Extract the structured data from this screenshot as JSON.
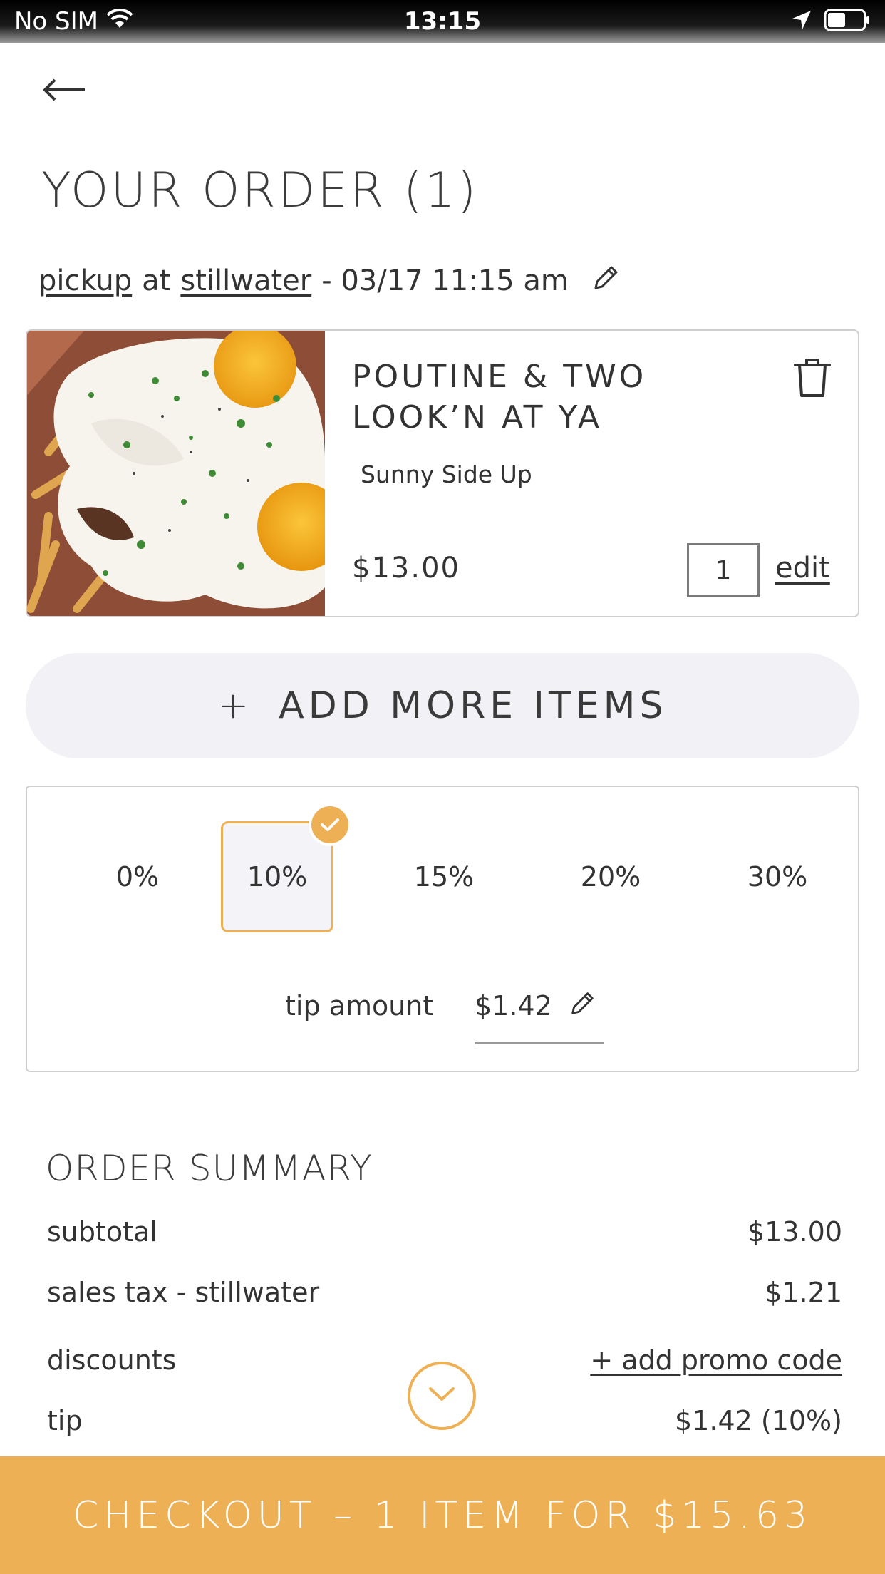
{
  "status_bar": {
    "carrier": "No SIM",
    "time": "13:15"
  },
  "header": {
    "title": "YOUR ORDER (1)"
  },
  "pickup": {
    "method": "pickup",
    "connector": "at",
    "location": "stillwater",
    "datetime": "- 03/17 11:15 am"
  },
  "cart_item": {
    "name": "POUTINE & TWO LOOK’N AT YA",
    "option": "Sunny Side Up",
    "price": "$13.00",
    "quantity": "1",
    "edit_label": "edit"
  },
  "add_more": {
    "plus": "+",
    "label": "ADD MORE ITEMS"
  },
  "tip": {
    "options": [
      "0%",
      "10%",
      "15%",
      "20%",
      "30%"
    ],
    "selected": "10%",
    "amount_label": "tip amount",
    "amount_value": "$1.42"
  },
  "summary": {
    "title": "ORDER SUMMARY",
    "subtotal_label": "subtotal",
    "subtotal_value": "$13.00",
    "tax_label": "sales tax - stillwater",
    "tax_value": "$1.21",
    "discounts_label": "discounts",
    "promo_link": "+ add promo code",
    "tip_label": "tip",
    "tip_value": "$1.42 (10%)"
  },
  "checkout": {
    "label": "CHECKOUT – 1 ITEM FOR $15.63"
  },
  "colors": {
    "accent": "#edb055",
    "pill_bg": "#f1f1f6",
    "text": "#333333",
    "border": "#cfcfcf"
  },
  "icons": [
    "wifi-icon",
    "location-arrow-icon",
    "battery-icon",
    "back-arrow-icon",
    "pencil-icon",
    "trash-icon",
    "check-icon",
    "chevron-down-icon"
  ]
}
